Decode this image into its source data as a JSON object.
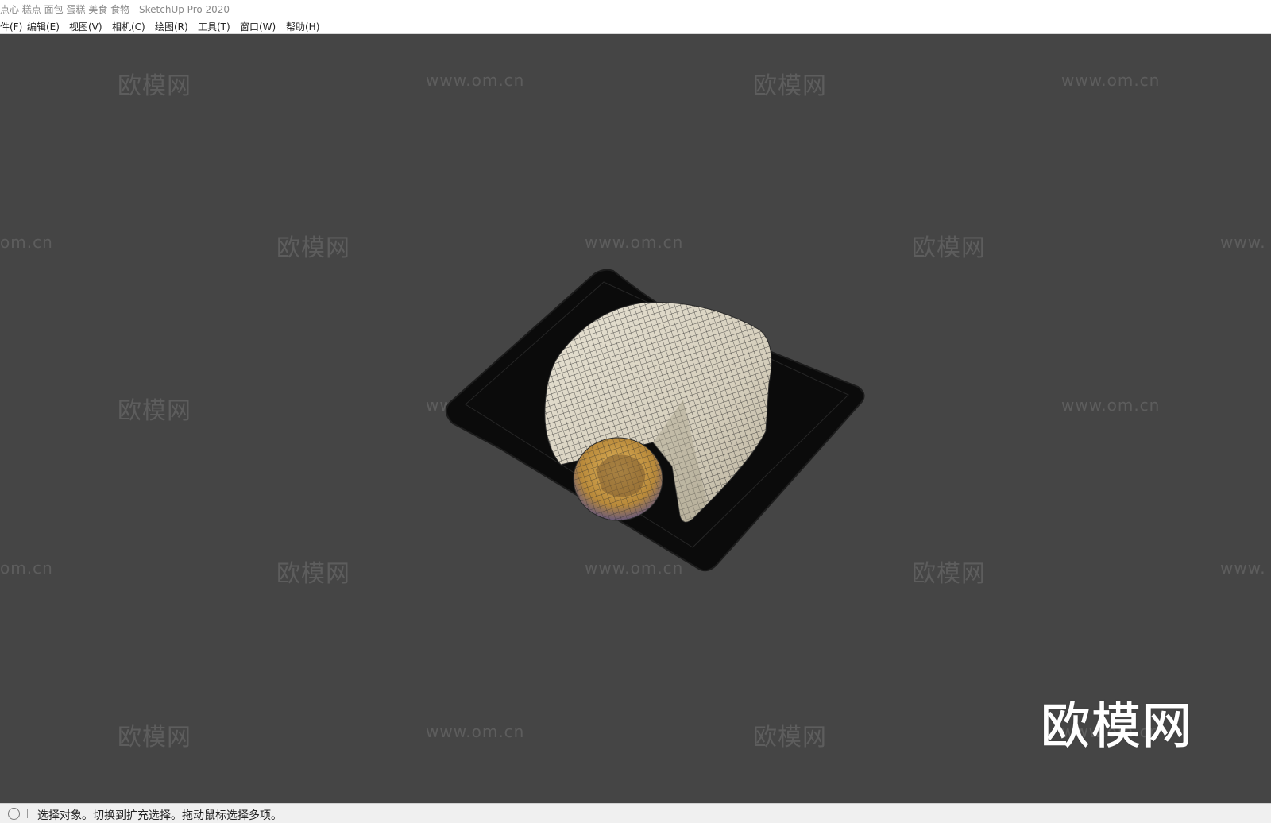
{
  "window": {
    "title": "点心 糕点 面包 蛋糕 美食 食物 - SketchUp Pro 2020"
  },
  "menu": {
    "items": [
      {
        "label": "件(F)"
      },
      {
        "label": "编辑(E)"
      },
      {
        "label": "视图(V)"
      },
      {
        "label": "相机(C)"
      },
      {
        "label": "绘图(R)"
      },
      {
        "label": "工具(T)"
      },
      {
        "label": "窗口(W)"
      },
      {
        "label": "帮助(H)"
      }
    ]
  },
  "viewport": {
    "watermark_cn": "欧模网",
    "watermark_url": "www.om.cn",
    "watermark_url_partial_left": "om.cn",
    "watermark_url_partial_right": "www.",
    "big_watermark": "欧模网",
    "model": {
      "subject": "cake-slice-on-black-square-plate",
      "colors": {
        "plate": "#0b0b0b",
        "cake": "#d9d4c6",
        "filling": "#c89a3c",
        "filling_bottom": "#5a6a9a"
      }
    }
  },
  "status": {
    "icon": "info-icon",
    "text": "选择对象。切换到扩充选择。拖动鼠标选择多项。"
  }
}
